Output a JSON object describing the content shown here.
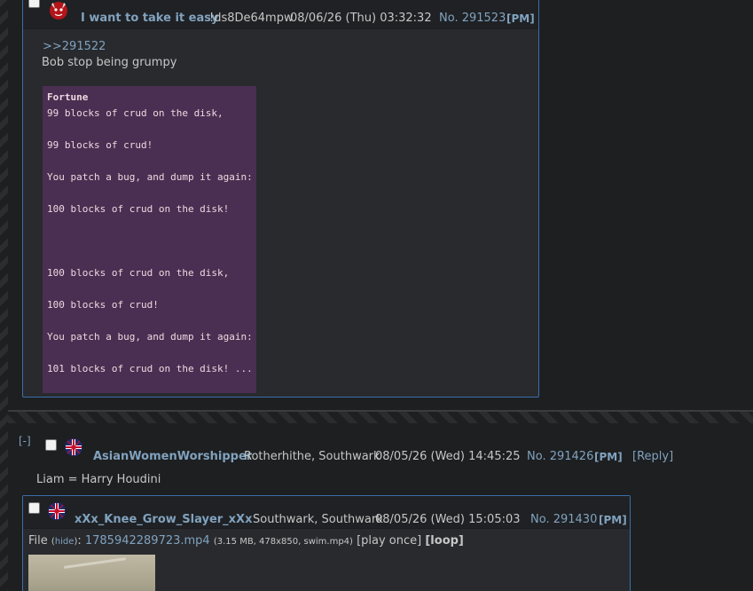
{
  "post_top": {
    "name": "I want to take it easy",
    "tripcode": "!ds8De64mpw",
    "date": "08/06/26 (Thu) 03:32:32",
    "number": "No. 291523",
    "pm": "[PM]",
    "quotelink": ">>291522",
    "text": "Bob stop being grumpy",
    "fortune_title": "Fortune",
    "fortune_lines": [
      "99 blocks of crud on the disk,",
      "",
      "99 blocks of crud!",
      "",
      "You patch a bug, and dump it again:",
      "",
      "100 blocks of crud on the disk!",
      "",
      "",
      "",
      "100 blocks of crud on the disk,",
      "",
      "100 blocks of crud!",
      "",
      "You patch a bug, and dump it again:",
      "",
      "101 blocks of crud on the disk! ..."
    ]
  },
  "thread_op": {
    "collapse": "[-]",
    "name": "AsianWomenWorshipper",
    "location": "Rotherhithe, Southwark",
    "date": "08/05/26 (Wed) 14:45:25",
    "number": "No. 291426",
    "pm": "[PM]",
    "reply": "[Reply]",
    "text": "Liam = Harry Houdini"
  },
  "post_bottom": {
    "name": "xXx_Knee_Grow_Slayer_xXx",
    "location": "Southwark, Southwark",
    "date": "08/05/26 (Wed) 15:05:03",
    "number": "No. 291430",
    "pm": "[PM]",
    "file_label": "File",
    "hide_label": "hide",
    "filename": "1785942289723.mp4",
    "fileinfo": "(3.15 MB, 478x850, swim.mp4)",
    "play_once": "[play once]",
    "loop": "[loop]"
  },
  "colors": {
    "background": "#1d1f21",
    "post_bg": "#282a2e",
    "link": "#81a2be",
    "fortune_bg": "#4a2f52",
    "fortune_text": "#f0d7e0",
    "border": "#3b6fa8"
  }
}
